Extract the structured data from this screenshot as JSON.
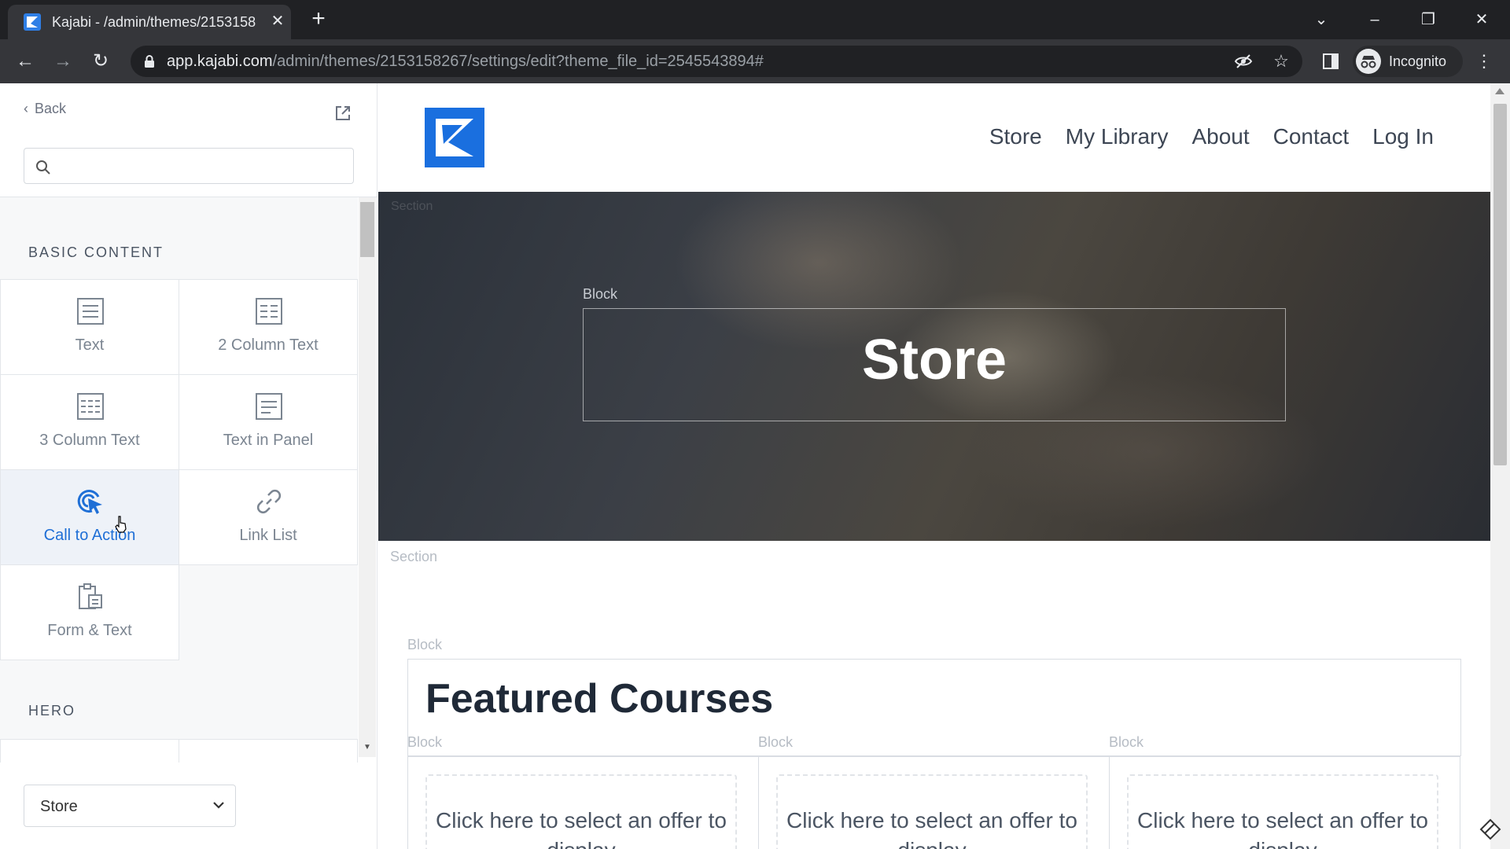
{
  "browser": {
    "tab_title": "Kajabi - /admin/themes/2153158",
    "url_host": "app.kajabi.com",
    "url_path": "/admin/themes/2153158267/settings/edit?theme_file_id=2545543894#",
    "profile_label": "Incognito"
  },
  "sidebar": {
    "back_label": "Back",
    "search_placeholder": "",
    "sections": [
      {
        "heading": "BASIC CONTENT",
        "items": [
          {
            "label": "Text",
            "icon": "text-icon"
          },
          {
            "label": "2 Column Text",
            "icon": "two-column-text-icon"
          },
          {
            "label": "3 Column Text",
            "icon": "three-column-text-icon"
          },
          {
            "label": "Text in Panel",
            "icon": "text-in-panel-icon"
          },
          {
            "label": "Call to Action",
            "icon": "call-to-action-icon"
          },
          {
            "label": "Link List",
            "icon": "link-icon"
          },
          {
            "label": "Form & Text",
            "icon": "form-text-icon"
          }
        ]
      },
      {
        "heading": "HERO",
        "items": []
      }
    ],
    "page_select": {
      "value": "Store"
    }
  },
  "preview": {
    "nav": [
      "Store",
      "My Library",
      "About",
      "Contact",
      "Log In"
    ],
    "hero_section_label": "Section",
    "hero_block_label": "Block",
    "hero_title": "Store",
    "section_label": "Section",
    "featured_block_label": "Block",
    "featured_title": "Featured Courses",
    "offer_block_label": "Block",
    "offer_cards": [
      {
        "text": "Click here to select an offer to display"
      },
      {
        "text": "Click here to select an offer to display"
      },
      {
        "text": "Click here to select an offer to display"
      }
    ]
  },
  "colors": {
    "accent": "#1f6fd6",
    "logo_blue": "#1a6fdf",
    "chrome_dark": "#202124"
  }
}
